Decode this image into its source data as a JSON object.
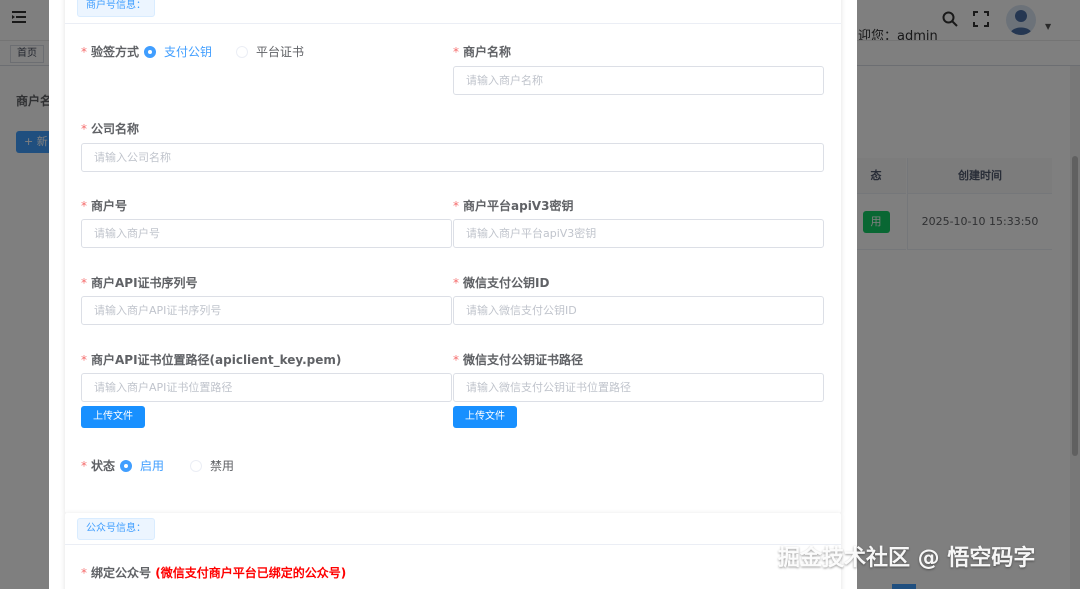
{
  "background": {
    "tags_bar": {
      "home_tab": "首页"
    },
    "search_label": "商户名",
    "add_button": "+ 新",
    "table": {
      "headers": {
        "status": "态",
        "created_time": "创建时间"
      },
      "row": {
        "status": "用",
        "created_time": "2025-10-10 15:33:50"
      }
    },
    "header": {
      "welcome": "迎您：admin"
    }
  },
  "dialog": {
    "merchant_section": {
      "title": "商户号信息：",
      "verify_method": {
        "label": "验签方式",
        "options": [
          "支付公钥",
          "平台证书"
        ],
        "selected": "支付公钥"
      },
      "merchant_name": {
        "label": "商户名称",
        "placeholder": "请输入商户名称"
      },
      "company_name": {
        "label": "公司名称",
        "placeholder": "请输入公司名称"
      },
      "merchant_no": {
        "label": "商户号",
        "placeholder": "请输入商户号"
      },
      "apiv3_key": {
        "label": "商户平台apiV3密钥",
        "placeholder": "请输入商户平台apiV3密钥"
      },
      "cert_serial": {
        "label": "商户API证书序列号",
        "placeholder": "请输入商户API证书序列号"
      },
      "pubkey_id": {
        "label": "微信支付公钥ID",
        "placeholder": "请输入微信支付公钥ID"
      },
      "cert_path": {
        "label": "商户API证书位置路径(apiclient_key.pem)",
        "placeholder": "请输入商户API证书位置路径",
        "upload_label": "上传文件"
      },
      "pubkey_cert_path": {
        "label": "微信支付公钥证书路径",
        "placeholder": "请输入微信支付公钥证书位置路径",
        "upload_label": "上传文件"
      },
      "status": {
        "label": "状态",
        "options": [
          "启用",
          "禁用"
        ],
        "selected": "启用"
      }
    },
    "official_section": {
      "title": "公众号信息：",
      "bind_label": "绑定公众号",
      "bind_hint": "(微信支付商户平台已绑定的公众号)"
    }
  },
  "watermark": "掘金技术社区 @ 悟空码字",
  "colors": {
    "primary": "#409eff",
    "required": "#f56c6c",
    "hint_red": "#ff0000",
    "success": "#13ce66"
  }
}
